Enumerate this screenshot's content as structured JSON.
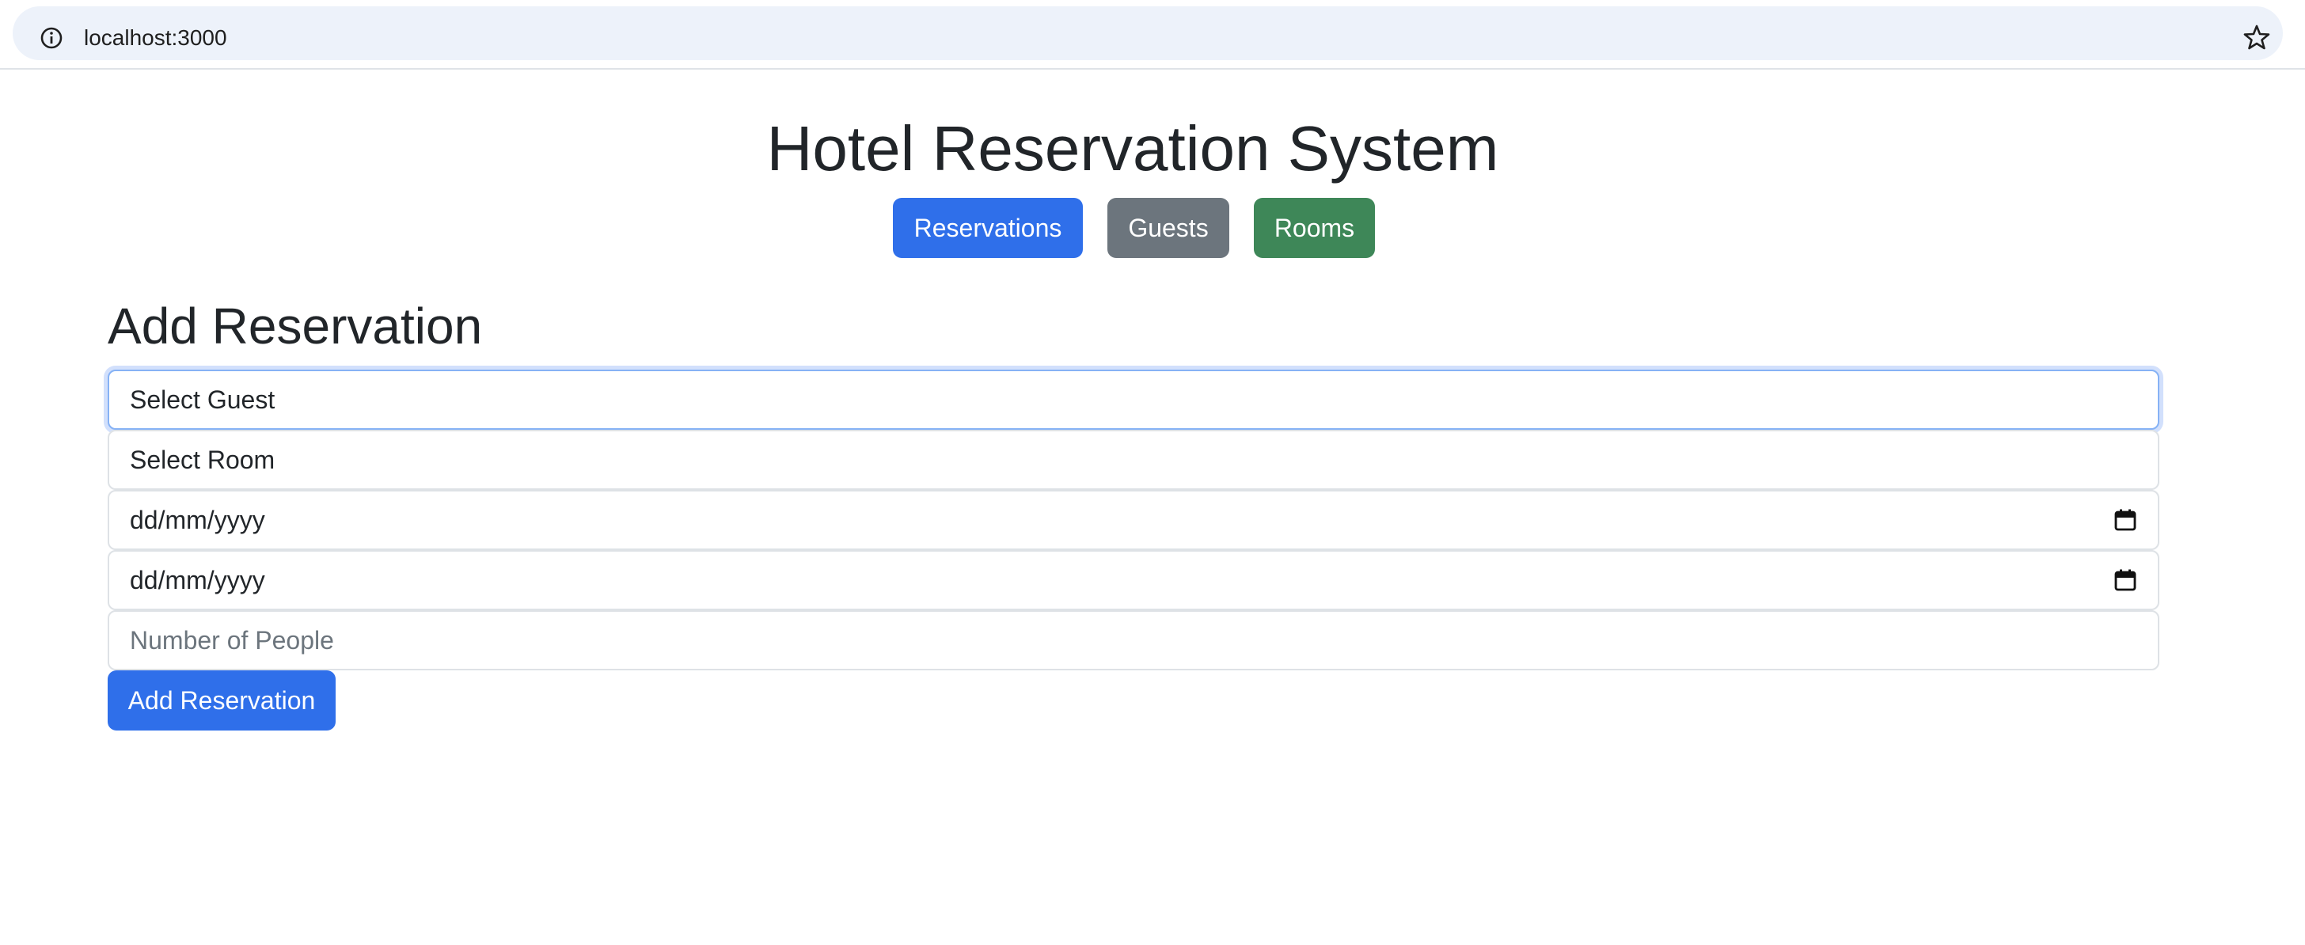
{
  "browser": {
    "url": "localhost:3000"
  },
  "header": {
    "title": "Hotel Reservation System",
    "nav": {
      "reservations": "Reservations",
      "guests": "Guests",
      "rooms": "Rooms"
    }
  },
  "form": {
    "title": "Add Reservation",
    "guest_select": "Select Guest",
    "room_select": "Select Room",
    "check_in_placeholder": "dd/mm/yyyy",
    "check_out_placeholder": "dd/mm/yyyy",
    "people_placeholder": "Number of People",
    "submit_label": "Add Reservation"
  },
  "icons": {
    "site_info": "info-icon",
    "bookmark": "star-icon",
    "date_picker": "calendar-icon"
  },
  "colors": {
    "primary": "#2f6fea",
    "secondary": "#6c757d",
    "success": "#3e8758",
    "focus_ring": "#86b2f5"
  }
}
